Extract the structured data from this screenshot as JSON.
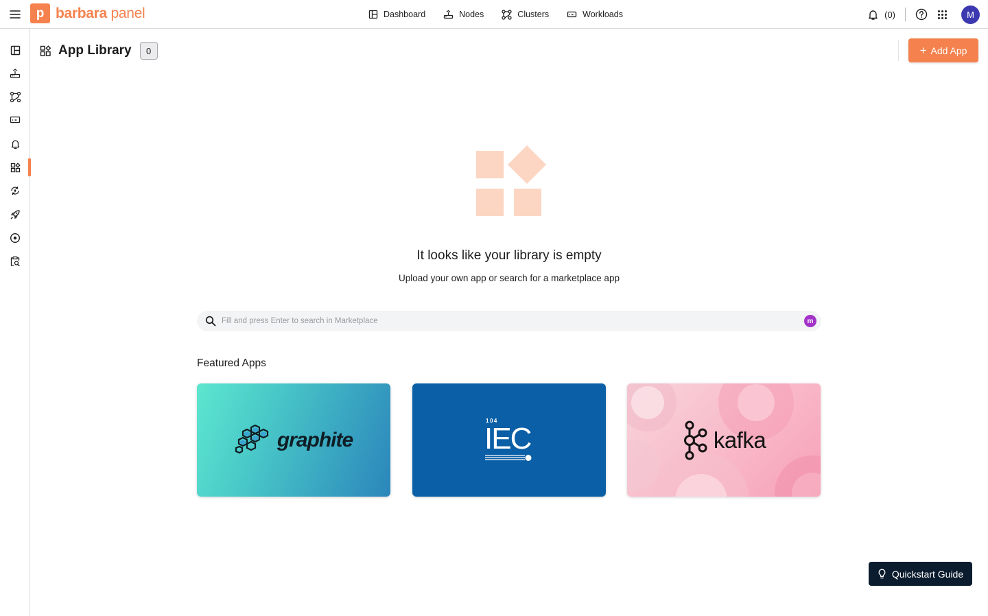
{
  "brand": {
    "mark_letter": "p",
    "name_part1": "barbara",
    "name_part2": " panel",
    "accent_color": "#f5824e"
  },
  "topnav": {
    "items": [
      {
        "label": "Dashboard",
        "icon": "dashboard-icon"
      },
      {
        "label": "Nodes",
        "icon": "nodes-icon"
      },
      {
        "label": "Clusters",
        "icon": "clusters-icon"
      },
      {
        "label": "Workloads",
        "icon": "workloads-icon"
      }
    ]
  },
  "topright": {
    "notifications_count": "(0)",
    "avatar_initial": "M",
    "avatar_color": "#3c38b0"
  },
  "sidebar": {
    "items": [
      {
        "icon": "dashboard-icon",
        "active": false
      },
      {
        "icon": "nodes-icon",
        "active": false
      },
      {
        "icon": "clusters-icon",
        "active": false
      },
      {
        "icon": "workloads-icon",
        "active": false
      },
      {
        "icon": "bell-icon",
        "active": false
      },
      {
        "icon": "app-library-icon",
        "active": true
      },
      {
        "icon": "sync-icon",
        "active": false
      },
      {
        "icon": "rocket-icon",
        "active": false
      },
      {
        "icon": "target-icon",
        "active": false
      },
      {
        "icon": "clipboard-search-icon",
        "active": false
      }
    ]
  },
  "page": {
    "title": "App Library",
    "count": "0",
    "add_button_plus": "+",
    "add_button_label": "Add App"
  },
  "empty_state": {
    "title": "It looks like your library is empty",
    "subtitle": "Upload your own app or search for a marketplace app"
  },
  "search": {
    "placeholder": "Fill and press Enter to search in Marketplace",
    "value": "",
    "marketplace_badge": "m"
  },
  "featured": {
    "title": "Featured Apps",
    "apps": [
      {
        "name": "graphite",
        "icon": "graphite-logo-icon"
      },
      {
        "name": "IEC",
        "number": "104",
        "icon": "iec-logo-icon"
      },
      {
        "name": "kafka",
        "icon": "kafka-logo-icon"
      }
    ]
  },
  "quickstart": {
    "label": "Quickstart Guide"
  }
}
